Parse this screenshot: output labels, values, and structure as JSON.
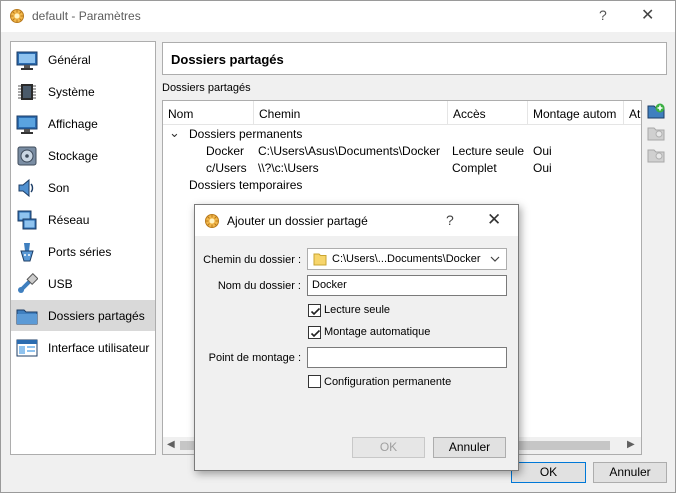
{
  "window": {
    "title": "default - Paramètres",
    "help_glyph": "?",
    "close_glyph": "✕"
  },
  "sidebar": {
    "items": [
      {
        "label": "Général",
        "icon": "monitor-general-icon"
      },
      {
        "label": "Système",
        "icon": "chip-icon"
      },
      {
        "label": "Affichage",
        "icon": "display-icon"
      },
      {
        "label": "Stockage",
        "icon": "disk-icon"
      },
      {
        "label": "Son",
        "icon": "speaker-icon"
      },
      {
        "label": "Réseau",
        "icon": "network-icon"
      },
      {
        "label": "Ports séries",
        "icon": "serial-port-icon"
      },
      {
        "label": "USB",
        "icon": "usb-icon"
      },
      {
        "label": "Dossiers partagés",
        "icon": "shared-folder-icon"
      },
      {
        "label": "Interface utilisateur",
        "icon": "user-interface-icon"
      }
    ],
    "selected_index": 8
  },
  "panel": {
    "title": "Dossiers partagés",
    "group_label": "Dossiers partagés"
  },
  "tree": {
    "columns": [
      "Nom",
      "Chemin",
      "Accès",
      "Montage autom",
      "At"
    ],
    "groups": [
      {
        "name": "Dossiers permanents",
        "expanded_glyph": "⌄",
        "rows": [
          {
            "name": "Docker",
            "path": "C:\\Users\\Asus\\Documents\\Docker",
            "access": "Lecture seule",
            "auto": "Oui"
          },
          {
            "name": "c/Users",
            "path": "\\\\?\\c:\\Users",
            "access": "Complet",
            "auto": "Oui"
          }
        ]
      },
      {
        "name": "Dossiers temporaires"
      }
    ]
  },
  "buttons": {
    "ok": "OK",
    "cancel": "Annuler"
  },
  "dialog": {
    "title": "Ajouter un dossier partagé",
    "help_glyph": "?",
    "close_glyph": "✕",
    "path_label": "Chemin du dossier :",
    "path_value": "C:\\Users\\...Documents\\Docker",
    "name_label": "Nom du dossier :",
    "name_value": "Docker",
    "readonly_label": "Lecture seule",
    "readonly_checked": true,
    "automount_label": "Montage automatique",
    "automount_checked": true,
    "mountpoint_label": "Point de montage :",
    "mountpoint_value": "",
    "permanent_label": "Configuration permanente",
    "permanent_checked": false,
    "ok": "OK",
    "cancel": "Annuler"
  },
  "colors": {
    "accent_border": "#0078d7",
    "selected_bg": "#d9d9d9",
    "folder_yellow": "#f7d56b"
  }
}
